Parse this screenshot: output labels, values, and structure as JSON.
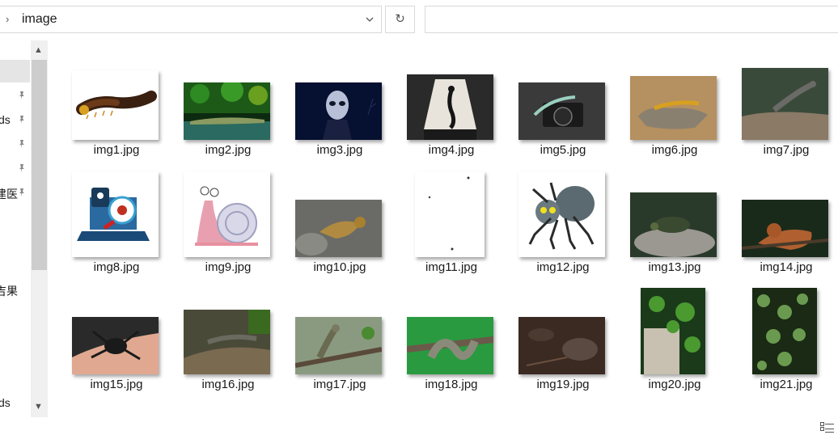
{
  "address": {
    "path": "image"
  },
  "nav": {
    "items": [
      {
        "label": "ds",
        "pinned": true
      },
      {
        "label": "",
        "pinned": true
      },
      {
        "label": "",
        "pinned": true
      },
      {
        "label": "建医",
        "pinned": true
      },
      {
        "label": "吉果",
        "pinned": false
      },
      {
        "label": "ds",
        "pinned": false
      }
    ]
  },
  "files": [
    {
      "name": "img1.jpg",
      "icon": "millipede-image"
    },
    {
      "name": "img2.jpg",
      "icon": "crocodile-image"
    },
    {
      "name": "img3.jpg",
      "icon": "alien-image"
    },
    {
      "name": "img4.jpg",
      "icon": "lamp-lizard-image"
    },
    {
      "name": "img5.jpg",
      "icon": "camera-lizard-image"
    },
    {
      "name": "img6.jpg",
      "icon": "lizard-on-rock-image"
    },
    {
      "name": "img7.jpg",
      "icon": "lizard-image"
    },
    {
      "name": "img8.jpg",
      "icon": "laptop-security-image"
    },
    {
      "name": "img9.jpg",
      "icon": "cartoon-snail-image"
    },
    {
      "name": "img10.jpg",
      "icon": "iguana-image"
    },
    {
      "name": "img11.jpg",
      "icon": "sparse-dots-image"
    },
    {
      "name": "img12.jpg",
      "icon": "cartoon-spider-image"
    },
    {
      "name": "img13.jpg",
      "icon": "turtle-image"
    },
    {
      "name": "img14.jpg",
      "icon": "iguana-image"
    },
    {
      "name": "img15.jpg",
      "icon": "tarantula-image"
    },
    {
      "name": "img16.jpg",
      "icon": "lizard-on-log-image"
    },
    {
      "name": "img17.jpg",
      "icon": "iguana-branch-image"
    },
    {
      "name": "img18.jpg",
      "icon": "snake-image"
    },
    {
      "name": "img19.jpg",
      "icon": "rocks-image"
    },
    {
      "name": "img20.jpg",
      "icon": "plant-stump-image"
    },
    {
      "name": "img21.jpg",
      "icon": "vine-leaves-image"
    }
  ],
  "icons": {
    "refresh": "refresh-icon",
    "dropdown": "chevron-down-icon"
  }
}
